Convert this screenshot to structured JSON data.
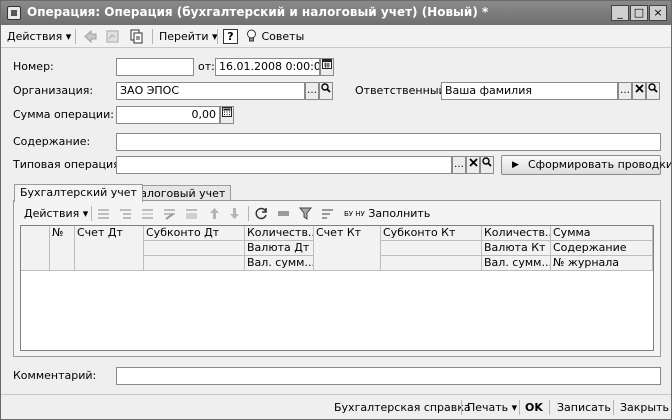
{
  "window": {
    "title": "Операция: Операция (бухгалтерский и налоговый учет) (Новый) *",
    "minimize_glyph": "_",
    "maximize_glyph": "□",
    "close_glyph": "×"
  },
  "toolbar": {
    "actions_label": "Действия",
    "goto_label": "Перейти",
    "help_glyph": "?",
    "tips_label": "Советы"
  },
  "form": {
    "number_label": "Номер:",
    "number_value": "",
    "date_from_label": "от:",
    "date_value": "16.01.2008  0:00:00",
    "organization_label": "Организация:",
    "organization_value": "ЗАО ЭПОС",
    "responsible_label": "Ответственный:",
    "responsible_value": "Ваша фамилия",
    "amount_label": "Сумма операции:",
    "amount_value": "0,00",
    "content_label": "Содержание:",
    "content_value": "",
    "typical_op_label": "Типовая операция:",
    "typical_op_value": "",
    "generate_button": "Сформировать проводки",
    "comment_label": "Комментарий:",
    "comment_value": ""
  },
  "tabs": [
    {
      "label": "Бухгалтерский учет",
      "active": true
    },
    {
      "label": "Налоговый учет",
      "active": false
    }
  ],
  "table_toolbar": {
    "actions_label": "Действия",
    "fill_label": "Заполнить",
    "fill_icon_text": "БУ НУ"
  },
  "table": {
    "headers": {
      "num": "№",
      "account_dt": "Счет Дт",
      "subconto_dt": "Субконто Дт",
      "qty_dt": "Количеств...",
      "currency_dt": "Валюта Дт",
      "cur_amount_dt": "Вал. сумм...",
      "account_kt": "Счет Кт",
      "subconto_kt": "Субконто Кт",
      "qty_kt": "Количеств...",
      "currency_kt": "Валюта Кт",
      "cur_amount_kt": "Вал. сумм...",
      "sum": "Сумма",
      "content": "Содержание",
      "journal_no": "№ журнала"
    },
    "rows": []
  },
  "statusbar": {
    "accounting_report": "Бухгалтерская справка",
    "print_label": "Печать",
    "ok_label": "OK",
    "save_label": "Записать",
    "close_label": "Закрыть"
  },
  "icons": {
    "app": "document-window-icon",
    "calendar": "calendar-icon",
    "calculator": "calculator-icon",
    "search": "magnifier-icon",
    "clear": "clear-x-icon"
  }
}
